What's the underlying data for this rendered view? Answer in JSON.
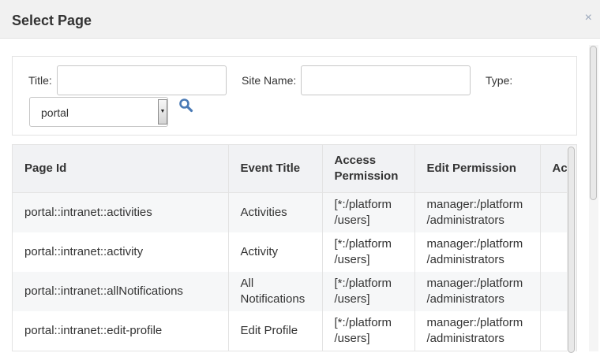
{
  "dialog": {
    "title": "Select Page",
    "close_glyph": "×"
  },
  "search": {
    "title_label": "Title:",
    "title_value": "",
    "site_name_label": "Site Name:",
    "site_name_value": "",
    "type_label": "Type:",
    "type_selected": "portal",
    "search_icon": "search-icon"
  },
  "table": {
    "columns": [
      "Page Id",
      "Event Title",
      "Access Permission",
      "Edit Permission",
      "Ac"
    ],
    "rows": [
      {
        "page_id": "portal::intranet::activities",
        "event_title": "Activities",
        "access_permission": "[*:/platform /users]",
        "edit_permission": "manager:/platform /administrators"
      },
      {
        "page_id": "portal::intranet::activity",
        "event_title": "Activity",
        "access_permission": "[*:/platform /users]",
        "edit_permission": "manager:/platform /administrators"
      },
      {
        "page_id": "portal::intranet::allNotifications",
        "event_title": "All Notifications",
        "access_permission": "[*:/platform /users]",
        "edit_permission": "manager:/platform /administrators"
      },
      {
        "page_id": "portal::intranet::edit-profile",
        "event_title": "Edit Profile",
        "access_permission": "[*:/platform /users]",
        "edit_permission": "manager:/platform /administrators"
      }
    ]
  },
  "colors": {
    "header_bg": "#f1f1f1",
    "accent_icon": "#4a7ab5"
  }
}
